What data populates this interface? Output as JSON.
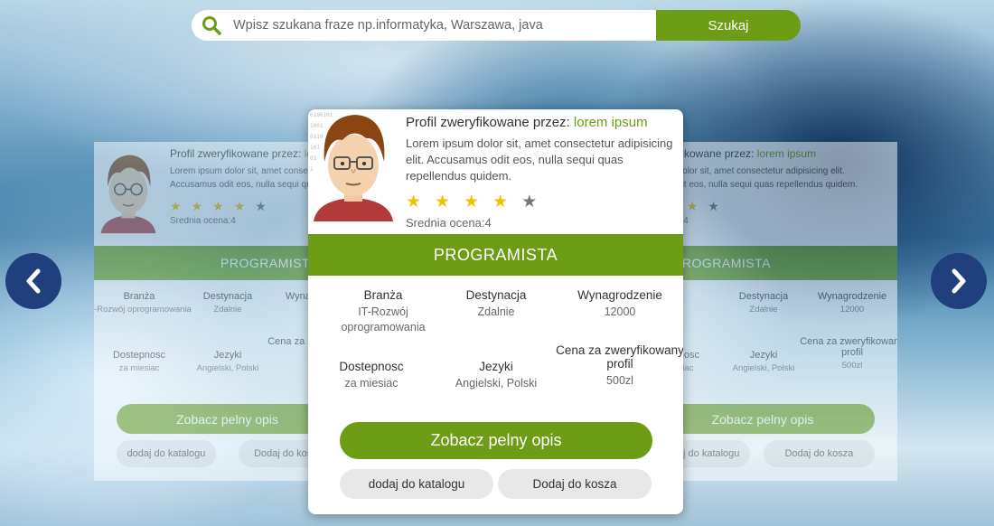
{
  "search": {
    "placeholder": "Wpisz szukana fraze np.informatyka, Warszawa, java",
    "button_label": "Szukaj"
  },
  "profile": {
    "verified_prefix": "Profil zweryfikowane przez:",
    "verified_name": "lorem ipsum",
    "description": "Lorem ipsum dolor sit, amet consectetur adipisicing elit. Accusamus odit eos, nulla sequi quas repellendus quidem.",
    "stars_filled": 4,
    "stars_total": 5,
    "rating_label": "Srednia ocena:4",
    "role": "PROGRAMISTA",
    "details": {
      "branza_label": "Branża",
      "branza_value": "IT-Rozwój oprogramowania",
      "destynacja_label": "Destynacja",
      "destynacja_value": "Zdalnie",
      "wynagrodzenie_label": "Wynagrodzenie",
      "wynagrodzenie_value": "12000",
      "dostepnosc_label": "Dostepnosc",
      "dostepnosc_value": "za miesiac",
      "jezyki_label": "Jezyki",
      "jezyki_value": "Angielski, Polski",
      "cena_label": "Cena za zweryfikowany profil",
      "cena_value": "500zl"
    },
    "cta_label": "Zobacz pelny opis",
    "catalog_label": "dodaj do katalogu",
    "cart_label": "Dodaj do kosza"
  },
  "colors": {
    "accent": "#6c9d14",
    "nav": "#1f3f7d",
    "star": "#f2c200"
  },
  "icons": {
    "search": "search-icon",
    "prev": "chevron-left-icon",
    "next": "chevron-right-icon",
    "star": "star-icon"
  }
}
